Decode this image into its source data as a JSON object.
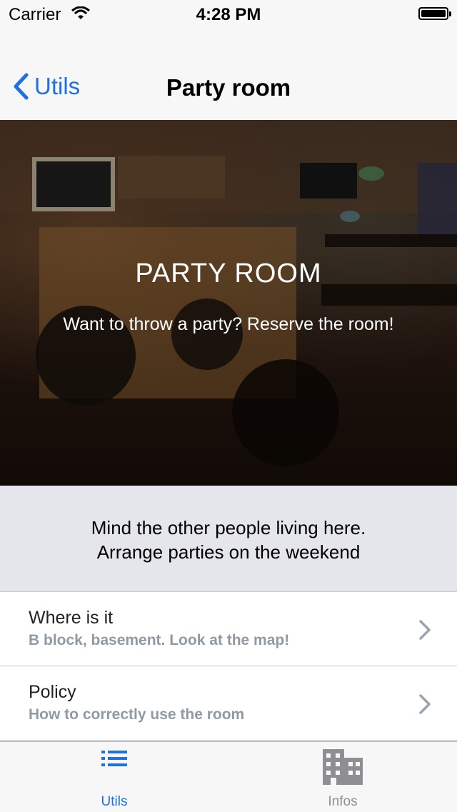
{
  "status_bar": {
    "carrier": "Carrier",
    "time": "4:28 PM"
  },
  "nav": {
    "back_label": "Utils",
    "title": "Party room"
  },
  "hero": {
    "title": "PARTY ROOM",
    "subtitle": "Want to throw a party? Reserve the room!"
  },
  "notice": {
    "line1": "Mind the other people living here.",
    "line2": "Arrange parties on the weekend"
  },
  "list": {
    "items": [
      {
        "title": "Where is it",
        "subtitle": "B block, basement. Look at the map!"
      },
      {
        "title": "Policy",
        "subtitle": "How to correctly use the room"
      }
    ]
  },
  "tabs": [
    {
      "label": "Utils",
      "icon": "list-icon",
      "active": true
    },
    {
      "label": "Infos",
      "icon": "building-icon",
      "active": false
    }
  ],
  "colors": {
    "accent": "#1f6fe5",
    "subtitle_gray": "#8f9aa3"
  }
}
